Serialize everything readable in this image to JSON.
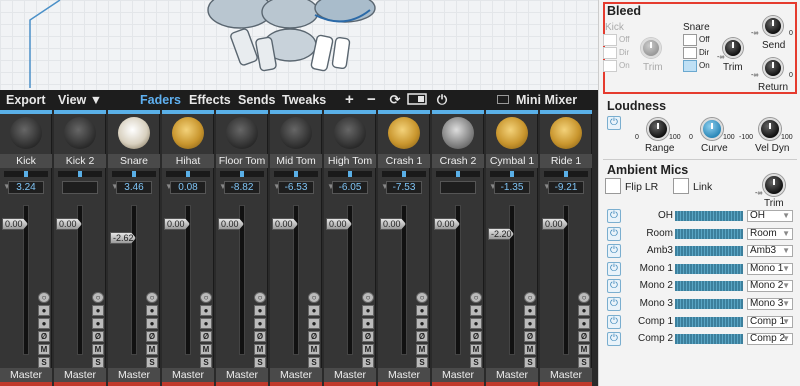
{
  "toolbar": {
    "export": "Export",
    "view": "View ▼",
    "faders": "Faders",
    "effects": "Effects",
    "sends": "Sends",
    "tweaks": "Tweaks",
    "plus": "+",
    "minus": "−",
    "mini_mixer": "Mini Mixer"
  },
  "channels": [
    {
      "name": "Kick",
      "value": "3.24",
      "fader": "0.00",
      "output": "Master"
    },
    {
      "name": "Kick 2",
      "value": "",
      "fader": "0.00",
      "output": "Master"
    },
    {
      "name": "Snare",
      "value": "3.46",
      "fader": "-2.62",
      "output": "Master"
    },
    {
      "name": "Hihat",
      "value": "0.08",
      "fader": "0.00",
      "output": "Master"
    },
    {
      "name": "Floor Tom",
      "value": "-8.82",
      "fader": "0.00",
      "output": "Master"
    },
    {
      "name": "Mid Tom",
      "value": "-6.53",
      "fader": "0.00",
      "output": "Master"
    },
    {
      "name": "High Tom",
      "value": "-6.05",
      "fader": "0.00",
      "output": "Master"
    },
    {
      "name": "Crash 1",
      "value": "-7.53",
      "fader": "0.00",
      "output": "Master"
    },
    {
      "name": "Crash 2",
      "value": "",
      "fader": "0.00",
      "output": "Master"
    },
    {
      "name": "Cymbal 1",
      "value": "-1.35",
      "fader": "-2.20",
      "output": "Master"
    },
    {
      "name": "Ride 1",
      "value": "-9.21",
      "fader": "0.00",
      "output": "Master"
    }
  ],
  "strip_buttons": {
    "mute": "M",
    "solo": "S",
    "phase": "Ø"
  },
  "bleed": {
    "title": "Bleed",
    "kick": "Kick",
    "snare": "Snare",
    "off": "Off",
    "dir": "Dir",
    "on": "On",
    "trim": "Trim",
    "send": "Send",
    "return": "Return",
    "minf": "-∞",
    "zero": "0"
  },
  "loudness": {
    "title": "Loudness",
    "range": "Range",
    "curve": "Curve",
    "vel_dyn": "Vel Dyn",
    "zero": "0",
    "hundred": "100",
    "minus100": "-100"
  },
  "ambient": {
    "title": "Ambient Mics",
    "flip": "Flip LR",
    "link": "Link",
    "trim": "Trim",
    "minf": "-∞",
    "rows": [
      {
        "label": "OH",
        "sel": "OH"
      },
      {
        "label": "Room",
        "sel": "Room"
      },
      {
        "label": "Amb3",
        "sel": "Amb3"
      },
      {
        "label": "Mono 1",
        "sel": "Mono 1"
      },
      {
        "label": "Mono 2",
        "sel": "Mono 2"
      },
      {
        "label": "Mono 3",
        "sel": "Mono 3"
      },
      {
        "label": "Comp 1",
        "sel": "Comp 1"
      },
      {
        "label": "Comp 2",
        "sel": "Comp 2"
      }
    ]
  }
}
